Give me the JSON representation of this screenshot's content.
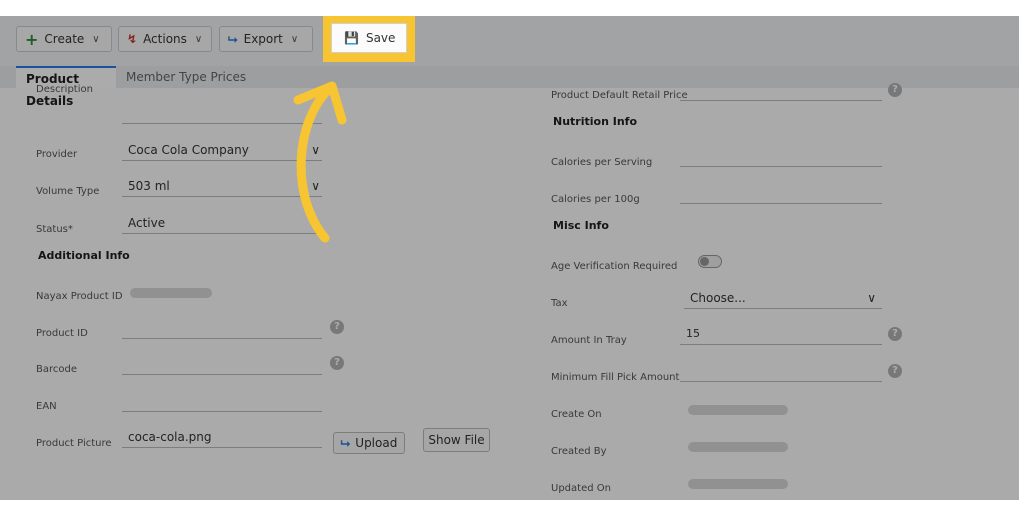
{
  "toolbar": {
    "create_label": "Create",
    "actions_label": "Actions",
    "export_label": "Export",
    "save_label": "Save"
  },
  "tabs": [
    {
      "label": "Product Details",
      "active": true
    },
    {
      "label": "Member Type Prices",
      "active": false
    }
  ],
  "left": {
    "description_label": "Description",
    "provider_label": "Provider",
    "provider_value": "Coca Cola Company",
    "volume_type_label": "Volume Type",
    "volume_type_value": "503 ml",
    "status_label": "Status",
    "status_required_mark": "*",
    "status_value": "Active",
    "additional_info_title": "Additional Info",
    "nayax_product_id_label": "Nayax Product ID",
    "product_id_label": "Product ID",
    "barcode_label": "Barcode",
    "ean_label": "EAN",
    "product_picture_label": "Product Picture",
    "product_picture_value": "coca-cola.png",
    "upload_label": "Upload",
    "show_file_label": "Show File"
  },
  "right": {
    "default_retail_price_label": "Product Default Retail Price",
    "nutrition_info_title": "Nutrition Info",
    "calories_serving_label": "Calories per Serving",
    "calories_100g_label": "Calories per 100g",
    "misc_info_title": "Misc Info",
    "age_verification_label": "Age Verification Required",
    "age_verification_on": false,
    "tax_label": "Tax",
    "tax_value": "Choose...",
    "amount_in_tray_label": "Amount In Tray",
    "amount_in_tray_value": "15",
    "min_fill_label": "Minimum Fill Pick Amount",
    "create_on_label": "Create On",
    "created_by_label": "Created By",
    "updated_on_label": "Updated On"
  },
  "help_glyph": "?",
  "colors": {
    "highlight": "#f7c531",
    "overlay": "rgba(0,0,0,0.33)",
    "arrow": "#f7c531"
  }
}
